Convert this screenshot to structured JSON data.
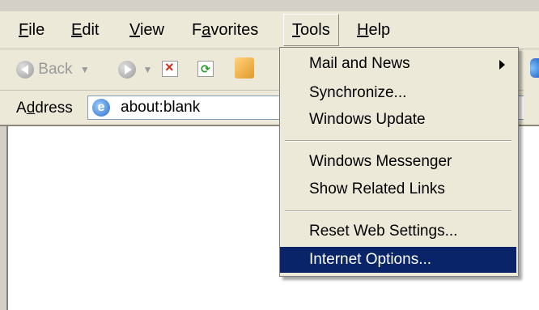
{
  "menubar": {
    "items": [
      {
        "accel": "F",
        "rest": "ile"
      },
      {
        "accel": "E",
        "rest": "dit"
      },
      {
        "accel": "V",
        "rest": "iew"
      },
      {
        "pre": "F",
        "accel": "a",
        "rest": "vorites"
      },
      {
        "accel": "T",
        "rest": "ools"
      },
      {
        "accel": "H",
        "rest": "elp"
      }
    ]
  },
  "toolbar": {
    "back_label": "Back",
    "icons": [
      "back-arrow-icon",
      "forward-arrow-icon",
      "stop-icon",
      "refresh-icon",
      "home-icon"
    ]
  },
  "address": {
    "label_pre": "A",
    "label_accel": "d",
    "label_rest": "dress",
    "value": "about:blank",
    "icon": "ie-page-icon"
  },
  "tools_menu": {
    "items": [
      {
        "label": "Mail and News",
        "has_submenu": true
      },
      {
        "label": "Synchronize..."
      },
      {
        "label": "Windows Update"
      },
      {
        "label": "Windows Messenger"
      },
      {
        "label": "Show Related Links"
      },
      {
        "label": "Reset Web Settings..."
      },
      {
        "label": "Internet Options...",
        "selected": true
      }
    ]
  },
  "colors": {
    "menu_bg": "#ece9d8",
    "selection": "#0a246a"
  }
}
